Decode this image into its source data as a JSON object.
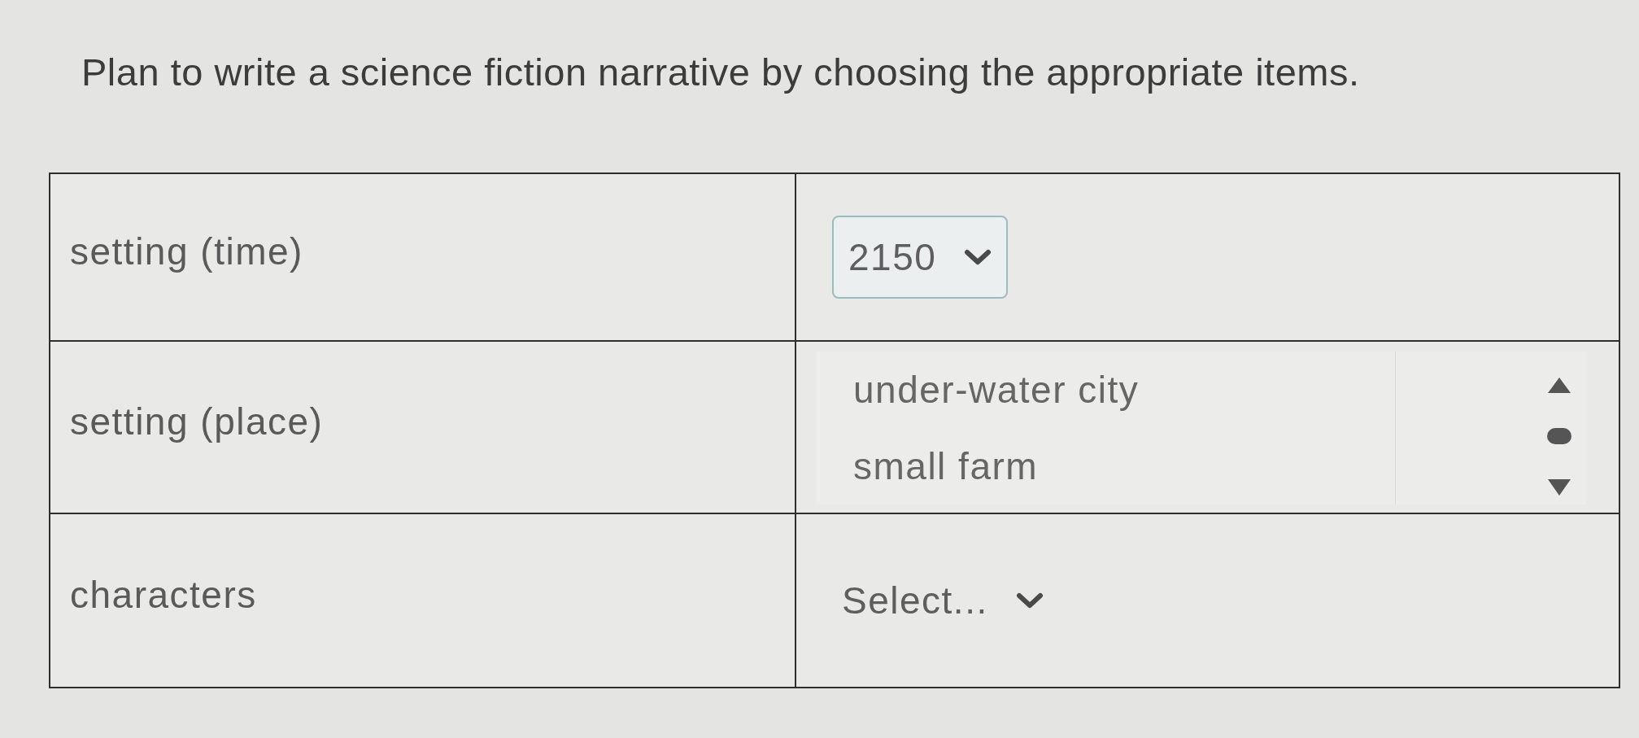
{
  "instruction": "Plan to write a science fiction narrative by choosing the appropriate items.",
  "table": {
    "rows": [
      {
        "label": "setting (time)",
        "control": {
          "kind": "dropdown",
          "value": "2150"
        }
      },
      {
        "label": "setting (place)",
        "control": {
          "kind": "listbox",
          "options": [
            {
              "label": "under-water city",
              "selected": false
            },
            {
              "label": "small farm",
              "selected": false
            }
          ]
        }
      },
      {
        "label": "characters",
        "control": {
          "kind": "dropdown",
          "placeholder": "Select..."
        }
      }
    ]
  }
}
